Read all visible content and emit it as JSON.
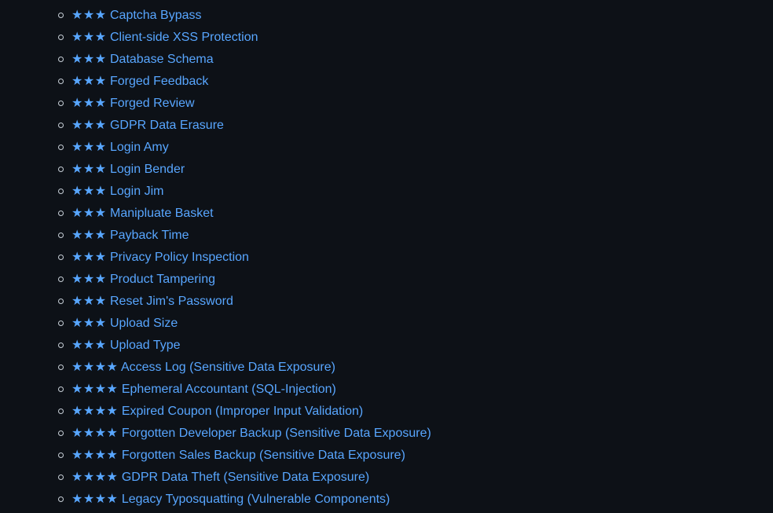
{
  "challenges": [
    {
      "stars": "★★★",
      "name": "Captcha Bypass"
    },
    {
      "stars": "★★★",
      "name": "Client-side XSS Protection"
    },
    {
      "stars": "★★★",
      "name": "Database Schema"
    },
    {
      "stars": "★★★",
      "name": "Forged Feedback"
    },
    {
      "stars": "★★★",
      "name": "Forged Review"
    },
    {
      "stars": "★★★",
      "name": "GDPR Data Erasure"
    },
    {
      "stars": "★★★",
      "name": "Login Amy"
    },
    {
      "stars": "★★★",
      "name": "Login Bender"
    },
    {
      "stars": "★★★",
      "name": "Login Jim"
    },
    {
      "stars": "★★★",
      "name": "Manipluate Basket"
    },
    {
      "stars": "★★★",
      "name": "Payback Time"
    },
    {
      "stars": "★★★",
      "name": "Privacy Policy Inspection"
    },
    {
      "stars": "★★★",
      "name": "Product Tampering"
    },
    {
      "stars": "★★★",
      "name": "Reset Jim's Password"
    },
    {
      "stars": "★★★",
      "name": "Upload Size"
    },
    {
      "stars": "★★★",
      "name": "Upload Type"
    },
    {
      "stars": "★★★★",
      "name": "Access Log (Sensitive Data Exposure)"
    },
    {
      "stars": "★★★★",
      "name": "Ephemeral Accountant (SQL-Injection)"
    },
    {
      "stars": "★★★★",
      "name": "Expired Coupon (Improper Input Validation)"
    },
    {
      "stars": "★★★★",
      "name": "Forgotten Developer Backup (Sensitive Data Exposure)"
    },
    {
      "stars": "★★★★",
      "name": "Forgotten Sales Backup (Sensitive Data Exposure)"
    },
    {
      "stars": "★★★★",
      "name": "GDPR Data Theft (Sensitive Data Exposure)"
    },
    {
      "stars": "★★★★",
      "name": "Legacy Typosquatting (Vulnerable Components)"
    }
  ]
}
